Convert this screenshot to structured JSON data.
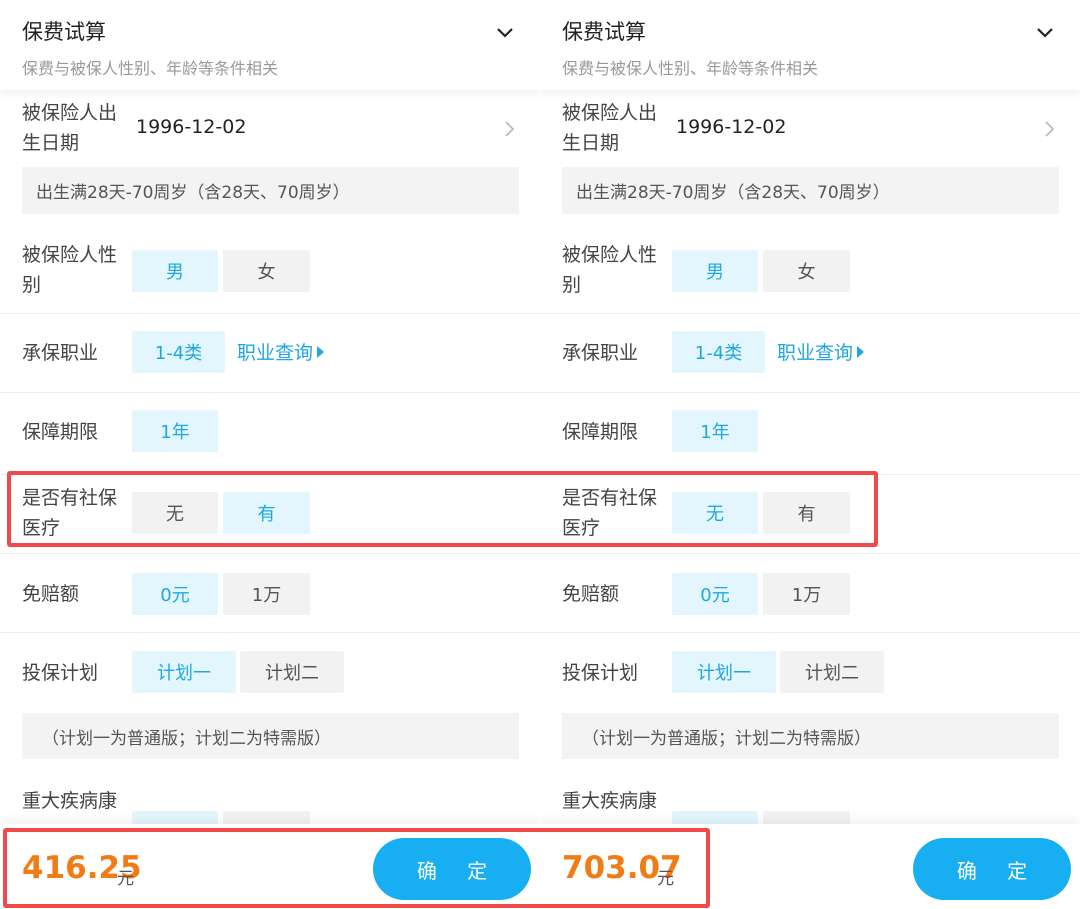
{
  "panels": [
    {
      "header": {
        "title": "保费试算",
        "subtitle": "保费与被保人性别、年龄等条件相关",
        "toggle_icon": "chevron-down-icon"
      },
      "birth": {
        "label_line1": "被保险人出",
        "label_line2": "生日期",
        "value": "1996-12-02",
        "note": "出生满28天-70周岁（含28天、70周岁）"
      },
      "gender": {
        "label_line1": "被保险人性",
        "label_line2": "别",
        "options": [
          "男",
          "女"
        ],
        "selected": "男"
      },
      "occupation": {
        "label": "承保职业",
        "option": "1-4类",
        "link": "职业查询"
      },
      "term": {
        "label": "保障期限",
        "option": "1年"
      },
      "social": {
        "label_line1": "是否有社保",
        "label_line2": "医疗",
        "options": [
          "无",
          "有"
        ],
        "selected": "有"
      },
      "deductible": {
        "label": "免赔额",
        "options": [
          "0元",
          "1万"
        ],
        "selected": "0元"
      },
      "plan": {
        "label": "投保计划",
        "options": [
          "计划一",
          "计划二"
        ],
        "selected": "计划一",
        "note": "（计划一为普通版；计划二为特需版）"
      },
      "critical": {
        "label": "重大疾病康"
      },
      "footer": {
        "price": "416.25",
        "unit": "元",
        "confirm": "确 定"
      }
    },
    {
      "header": {
        "title": "保费试算",
        "subtitle": "保费与被保人性别、年龄等条件相关",
        "toggle_icon": "chevron-down-icon"
      },
      "birth": {
        "label_line1": "被保险人出",
        "label_line2": "生日期",
        "value": "1996-12-02",
        "note": "出生满28天-70周岁（含28天、70周岁）"
      },
      "gender": {
        "label_line1": "被保险人性",
        "label_line2": "别",
        "options": [
          "男",
          "女"
        ],
        "selected": "男"
      },
      "occupation": {
        "label": "承保职业",
        "option": "1-4类",
        "link": "职业查询"
      },
      "term": {
        "label": "保障期限",
        "option": "1年"
      },
      "social": {
        "label_line1": "是否有社保",
        "label_line2": "医疗",
        "options": [
          "无",
          "有"
        ],
        "selected": "无"
      },
      "deductible": {
        "label": "免赔额",
        "options": [
          "0元",
          "1万"
        ],
        "selected": "0元"
      },
      "plan": {
        "label": "投保计划",
        "options": [
          "计划一",
          "计划二"
        ],
        "selected": "计划一",
        "note": "（计划一为普通版；计划二为特需版）"
      },
      "critical": {
        "label": "重大疾病康"
      },
      "footer": {
        "price": "703.07",
        "unit": "元",
        "confirm": "确 定"
      }
    }
  ],
  "colors": {
    "accent": "#17aef2",
    "selected_bg": "#e3f6fd",
    "selected_text": "#1fa8e0",
    "price": "#f07c16",
    "highlight": "#ef4a4a"
  }
}
